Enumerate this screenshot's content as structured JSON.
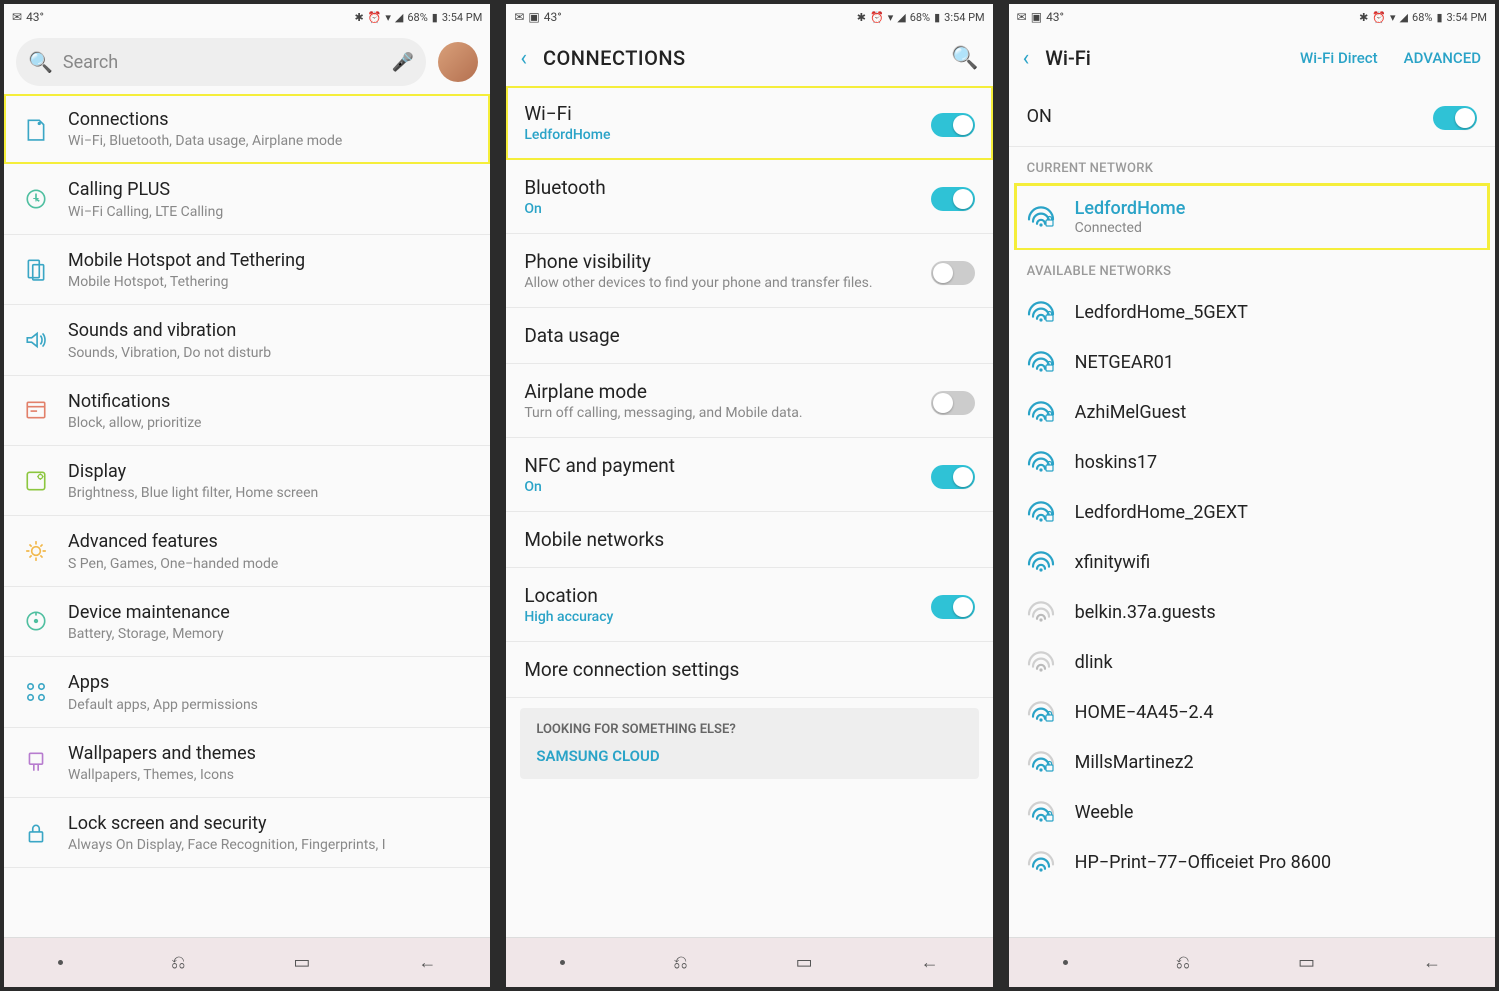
{
  "status": {
    "temp": "43°",
    "battery_pct": "68%",
    "time": "3:54 PM",
    "mail_icon": "✉"
  },
  "phone1": {
    "search_placeholder": "Search",
    "items": [
      {
        "icon": "connections",
        "color": "#3aa6c5",
        "title": "Connections",
        "sub": "Wi−Fi, Bluetooth, Data usage, Airplane mode",
        "hl": true
      },
      {
        "icon": "calling",
        "color": "#4fbfa0",
        "title": "Calling PLUS",
        "sub": "Wi−Fi Calling, LTE Calling"
      },
      {
        "icon": "hotspot",
        "color": "#3aa6c5",
        "title": "Mobile Hotspot and Tethering",
        "sub": "Mobile Hotspot, Tethering"
      },
      {
        "icon": "sound",
        "color": "#3aa6c5",
        "title": "Sounds and vibration",
        "sub": "Sounds, Vibration, Do not disturb"
      },
      {
        "icon": "notif",
        "color": "#e2806a",
        "title": "Notifications",
        "sub": "Block, allow, prioritize"
      },
      {
        "icon": "display",
        "color": "#8cc63f",
        "title": "Display",
        "sub": "Brightness, Blue light filter, Home screen"
      },
      {
        "icon": "adv",
        "color": "#f2b84b",
        "title": "Advanced features",
        "sub": "S Pen, Games, One−handed mode"
      },
      {
        "icon": "maint",
        "color": "#4fbfa0",
        "title": "Device maintenance",
        "sub": "Battery, Storage, Memory"
      },
      {
        "icon": "apps",
        "color": "#3aa6c5",
        "title": "Apps",
        "sub": "Default apps, App permissions"
      },
      {
        "icon": "wall",
        "color": "#b77ccf",
        "title": "Wallpapers and themes",
        "sub": "Wallpapers, Themes, Icons"
      },
      {
        "icon": "lock",
        "color": "#3aa6c5",
        "title": "Lock screen and security",
        "sub": "Always On Display, Face Recognition, Fingerprints, I"
      }
    ]
  },
  "phone2": {
    "title": "CONNECTIONS",
    "items": [
      {
        "title": "Wi−Fi",
        "sub": "LedfordHome",
        "sub_accent": true,
        "toggle": true,
        "on": true,
        "hl": true
      },
      {
        "title": "Bluetooth",
        "sub": "On",
        "sub_accent": true,
        "toggle": true,
        "on": true
      },
      {
        "title": "Phone visibility",
        "sub": "Allow other devices to find your phone and transfer files.",
        "toggle": true,
        "on": false
      },
      {
        "title": "Data usage"
      },
      {
        "title": "Airplane mode",
        "sub": "Turn off calling, messaging, and Mobile data.",
        "toggle": true,
        "on": false
      },
      {
        "title": "NFC and payment",
        "sub": "On",
        "sub_accent": true,
        "toggle": true,
        "on": true
      },
      {
        "title": "Mobile networks"
      },
      {
        "title": "Location",
        "sub": "High accuracy",
        "sub_accent": true,
        "toggle": true,
        "on": true
      },
      {
        "title": "More connection settings"
      }
    ],
    "card_hdr": "LOOKING FOR SOMETHING ELSE?",
    "card_link": "SAMSUNG CLOUD"
  },
  "phone3": {
    "title": "Wi-Fi",
    "action1": "Wi-Fi Direct",
    "action2": "ADVANCED",
    "on_label": "ON",
    "current_hdr": "CURRENT NETWORK",
    "avail_hdr": "AVAILABLE NETWORKS",
    "current": {
      "name": "LedfordHome",
      "sub": "Connected",
      "strength": 3,
      "locked": true,
      "accent": true
    },
    "networks": [
      {
        "name": "LedfordHome_5GEXT",
        "strength": 3,
        "locked": true
      },
      {
        "name": "NETGEAR01",
        "strength": 3,
        "locked": true
      },
      {
        "name": "AzhiMelGuest",
        "strength": 3,
        "locked": true
      },
      {
        "name": "hoskins17",
        "strength": 3,
        "locked": true
      },
      {
        "name": "LedfordHome_2GEXT",
        "strength": 3,
        "locked": true
      },
      {
        "name": "xfinitywifi",
        "strength": 3,
        "locked": false
      },
      {
        "name": "belkin.37a.guests",
        "strength": 1,
        "locked": false
      },
      {
        "name": "dlink",
        "strength": 1,
        "locked": false
      },
      {
        "name": "HOME−4A45−2.4",
        "strength": 2,
        "locked": true
      },
      {
        "name": "MillsMartinez2",
        "strength": 2,
        "locked": true
      },
      {
        "name": "Weeble",
        "strength": 2,
        "locked": true
      },
      {
        "name": "HP−Print−77−Officeiet Pro 8600",
        "strength": 2,
        "locked": false
      }
    ]
  }
}
